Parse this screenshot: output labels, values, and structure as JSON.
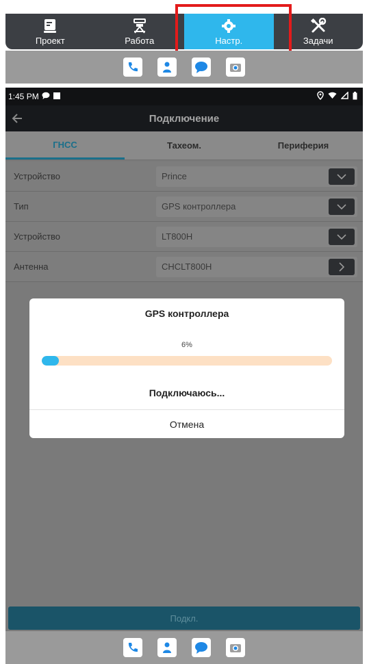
{
  "top_tabs": [
    {
      "label": "Проект",
      "icon": "project-icon"
    },
    {
      "label": "Работа",
      "icon": "survey-icon"
    },
    {
      "label": "Настр.",
      "icon": "gear-icon",
      "active": true
    },
    {
      "label": "Задачи",
      "icon": "tools-icon"
    }
  ],
  "dock_icons": [
    "phone-icon",
    "contacts-icon",
    "messages-icon",
    "camera-icon"
  ],
  "status_bar": {
    "time": "1:45 PM"
  },
  "app_bar": {
    "title": "Подключение"
  },
  "sub_tabs": [
    {
      "label": "ГНСС",
      "active": true
    },
    {
      "label": "Тахеом."
    },
    {
      "label": "Периферия"
    }
  ],
  "settings_rows": [
    {
      "label": "Устройство",
      "value": "Prince",
      "control": "dropdown"
    },
    {
      "label": "Тип",
      "value": "GPS контроллера",
      "control": "dropdown"
    },
    {
      "label": "Устройство",
      "value": "LT800H",
      "control": "dropdown"
    },
    {
      "label": "Антенна",
      "value": "CHCLT800H",
      "control": "arrow"
    }
  ],
  "connect_button": "Подкл.",
  "dialog": {
    "title": "GPS контроллера",
    "percent_text": "6%",
    "progress": 0.06,
    "status": "Подключаюсь...",
    "cancel": "Отмена"
  },
  "colors": {
    "accent": "#2fb7ec",
    "highlight": "#e31b1b",
    "progress_track": "#fde0c4"
  }
}
